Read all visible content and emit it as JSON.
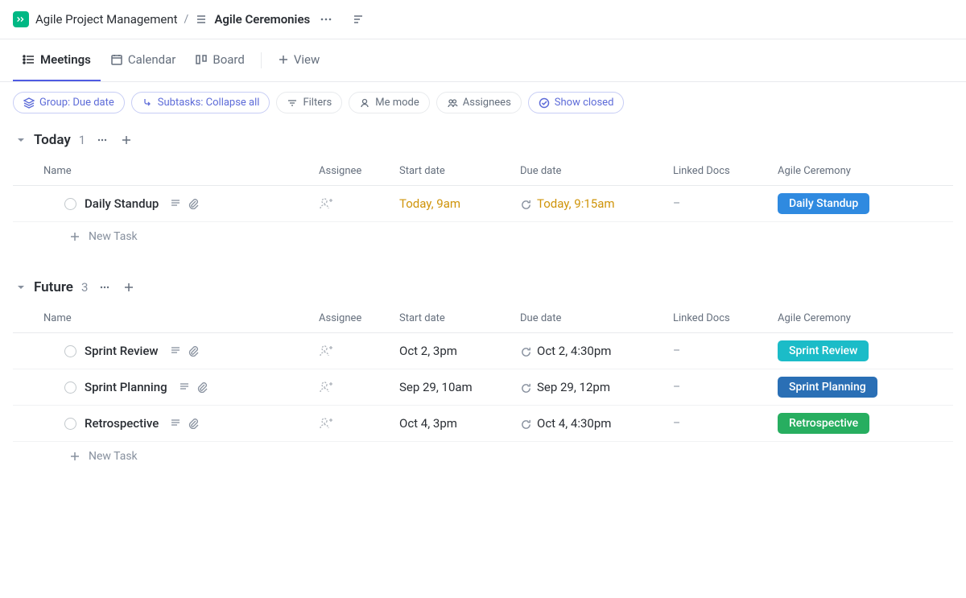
{
  "breadcrumb": {
    "project": "Agile Project Management",
    "list": "Agile Ceremonies"
  },
  "tabs": [
    {
      "label": "Meetings",
      "active": true
    },
    {
      "label": "Calendar",
      "active": false
    },
    {
      "label": "Board",
      "active": false
    }
  ],
  "view_add": "View",
  "filters": {
    "group": "Group: Due date",
    "subtasks": "Subtasks: Collapse all",
    "filters": "Filters",
    "me_mode": "Me mode",
    "assignees": "Assignees",
    "show_closed": "Show closed"
  },
  "columns": {
    "name": "Name",
    "assignee": "Assignee",
    "start": "Start date",
    "due": "Due date",
    "docs": "Linked Docs",
    "ceremony": "Agile Ceremony"
  },
  "groups": [
    {
      "title": "Today",
      "count": "1",
      "tasks": [
        {
          "name": "Daily Standup",
          "start": "Today, 9am",
          "start_warn": true,
          "due": "Today, 9:15am",
          "due_warn": true,
          "recurring": true,
          "docs": "–",
          "ceremony": "Daily Standup",
          "ceremony_color": "#2f8ae0"
        }
      ]
    },
    {
      "title": "Future",
      "count": "3",
      "tasks": [
        {
          "name": "Sprint Review",
          "start": "Oct 2, 3pm",
          "start_warn": false,
          "due": "Oct 2, 4:30pm",
          "due_warn": false,
          "recurring": true,
          "docs": "–",
          "ceremony": "Sprint Review",
          "ceremony_color": "#1bbcc8"
        },
        {
          "name": "Sprint Planning",
          "start": "Sep 29, 10am",
          "start_warn": false,
          "due": "Sep 29, 12pm",
          "due_warn": false,
          "recurring": true,
          "docs": "–",
          "ceremony": "Sprint Planning",
          "ceremony_color": "#2a6fb5"
        },
        {
          "name": "Retrospective",
          "start": "Oct 4, 3pm",
          "start_warn": false,
          "due": "Oct 4, 4:30pm",
          "due_warn": false,
          "recurring": true,
          "docs": "–",
          "ceremony": "Retrospective",
          "ceremony_color": "#27ae60"
        }
      ]
    }
  ],
  "new_task": "New Task"
}
